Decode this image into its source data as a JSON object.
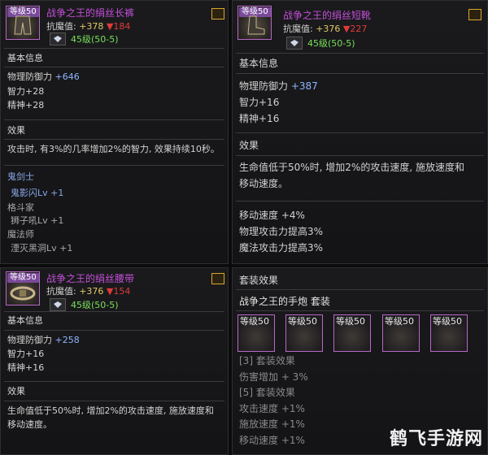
{
  "panels": [
    {
      "level_badge": "等级50",
      "name": "战争之王的绢丝长裤",
      "resist_label": "抗魔值: ",
      "resist_up": "+378",
      "resist_down": "▼184",
      "gem_text": "45级(50-5)",
      "basic_title": "基本信息",
      "stats": [
        {
          "label": "物理防御力 ",
          "value": "+646"
        },
        {
          "label": "智力+28",
          "value": ""
        },
        {
          "label": "精神+28",
          "value": ""
        }
      ],
      "effect_title": "效果",
      "effect_lines": [
        "攻击时, 有3%的几率增加2%的智力, 效果持续10秒。"
      ],
      "class_name": "鬼剑士",
      "class_skill": "鬼影闪Lv +1",
      "sub_class": "格斗家",
      "sub_skill": "狮子吼Lv +1",
      "mage_class": "魔法师",
      "mage_skill": "湮灭黑洞Lv +1"
    },
    {
      "level_badge": "等级50",
      "name": "战争之王的绢丝短靴",
      "resist_label": "抗魔值: ",
      "resist_up": "+376",
      "resist_down": "▼227",
      "gem_text": "45级(50-5)",
      "basic_title": "基本信息",
      "stats": [
        {
          "label": "物理防御力 ",
          "value": "+387"
        },
        {
          "label": "智力+16",
          "value": ""
        },
        {
          "label": "精神+16",
          "value": ""
        }
      ],
      "effect_title": "效果",
      "effect_lines": [
        "生命值低于50%时, 增加2%的攻击速度, 施放速度和",
        "移动速度。"
      ],
      "extra_lines": [
        "移动速度 +4%",
        "物理攻击力提高3%",
        "魔法攻击力提高3%"
      ]
    },
    {
      "level_badge": "等级50",
      "name": "战争之王的绢丝腰带",
      "resist_label": "抗魔值: ",
      "resist_up": "+376",
      "resist_down": "▼154",
      "gem_text": "45级(50-5)",
      "basic_title": "基本信息",
      "stats": [
        {
          "label": "物理防御力 ",
          "value": "+258"
        },
        {
          "label": "智力+16",
          "value": ""
        },
        {
          "label": "精神+16",
          "value": ""
        }
      ],
      "effect_title": "效果",
      "effect_lines": [
        "生命值低于50%时, 增加2%的攻击速度, 施放速度和",
        "移动速度。"
      ]
    }
  ],
  "set_panel": {
    "title": "套装效果",
    "set_name": "战争之王的手炮 套装",
    "pieces": [
      "等级50",
      "等级50",
      "等级50",
      "等级50",
      "等级50"
    ],
    "lines": [
      "[3] 套装效果",
      "伤害增加 + 3%",
      "[5] 套装效果",
      "攻击速度 +1%",
      "施放速度 +1%",
      "移动速度 +1%"
    ]
  },
  "watermark": "鹤飞手游网",
  "colors": {
    "item_name": "#c34fd8",
    "resist_up": "#e2c766",
    "resist_down": "#e03a3a",
    "gem_text": "#78e05a",
    "bonus": "#8fb4ff",
    "class_text": "#88a6e8"
  }
}
